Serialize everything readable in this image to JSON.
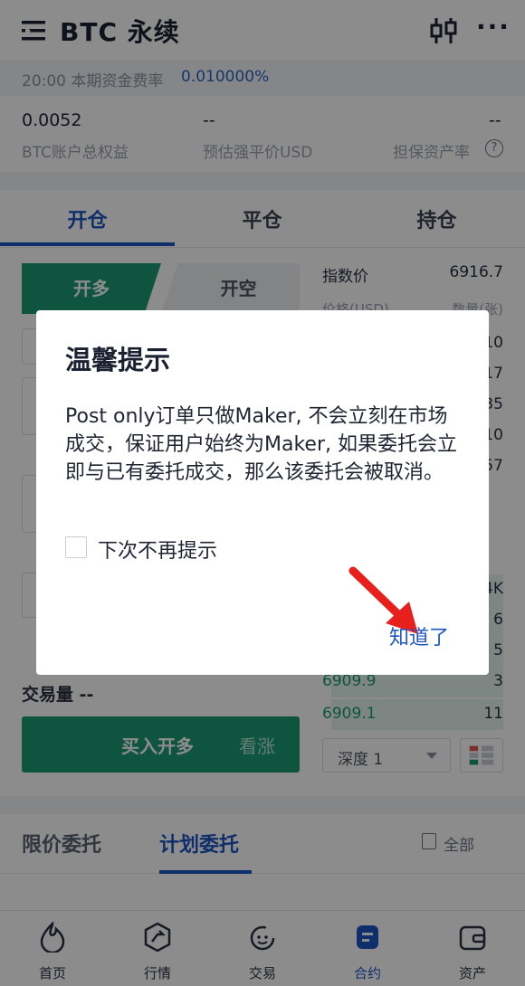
{
  "header": {
    "title": "BTC 永续",
    "menu_icon": "menu-icon",
    "chart_icon": "candlestick-icon",
    "more_icon": "more-icon",
    "more_glyph": "···"
  },
  "funding": {
    "label": "20:00 本期资金费率",
    "value": "0.010000%"
  },
  "stats": [
    {
      "value": "0.0052",
      "label": "BTC账户总权益"
    },
    {
      "value": "--",
      "label": "预估强平价USD"
    },
    {
      "value": "--",
      "label": "担保资产率"
    }
  ],
  "help_glyph": "?",
  "tabs": [
    "开仓",
    "平仓",
    "持仓"
  ],
  "trade": {
    "long_label": "开多",
    "short_label": "开空",
    "volume_label": "交易量 --",
    "buy_main": "买入开多",
    "buy_sub": "看涨"
  },
  "orderbook": {
    "index_label": "指数价",
    "index_value": "6916.7",
    "header_price": "价格(USD)",
    "header_amount": "数量(张)",
    "asks": [
      {
        "amount": "10"
      },
      {
        "amount": "17"
      },
      {
        "amount": "35"
      },
      {
        "amount": "10"
      },
      {
        "amount": "57"
      }
    ],
    "bids": [
      {
        "price": "",
        "amount": "4K",
        "depth": 0.2
      },
      {
        "price": "",
        "amount": "6",
        "depth": 0.2
      },
      {
        "price": "",
        "amount": "5",
        "depth": 0.2
      },
      {
        "price": "6909.9",
        "amount": "3",
        "depth": 0.95
      },
      {
        "price": "6909.1",
        "amount": "11",
        "depth": 0.95
      }
    ],
    "depth_label": "深度 1"
  },
  "orders": {
    "tabs": [
      "限价委托",
      "计划委托"
    ],
    "all_label": "全部"
  },
  "nav": [
    {
      "label": "首页",
      "icon": "home-icon"
    },
    {
      "label": "行情",
      "icon": "market-icon"
    },
    {
      "label": "交易",
      "icon": "trade-icon"
    },
    {
      "label": "合约",
      "icon": "contract-icon"
    },
    {
      "label": "资产",
      "icon": "wallet-icon"
    }
  ],
  "dialog": {
    "title": "温馨提示",
    "body": "Post only订单只做Maker, 不会立刻在市场成交，保证用户始终为Maker, 如果委托会立即与已有委托成交，那么该委托会被取消。",
    "checkbox_label": "下次不再提示",
    "checkbox_checked": false,
    "ok_label": "知道了"
  },
  "colors": {
    "accent": "#1d56c4",
    "buy": "#1a9a74",
    "annotation_arrow": "#e8201b"
  }
}
